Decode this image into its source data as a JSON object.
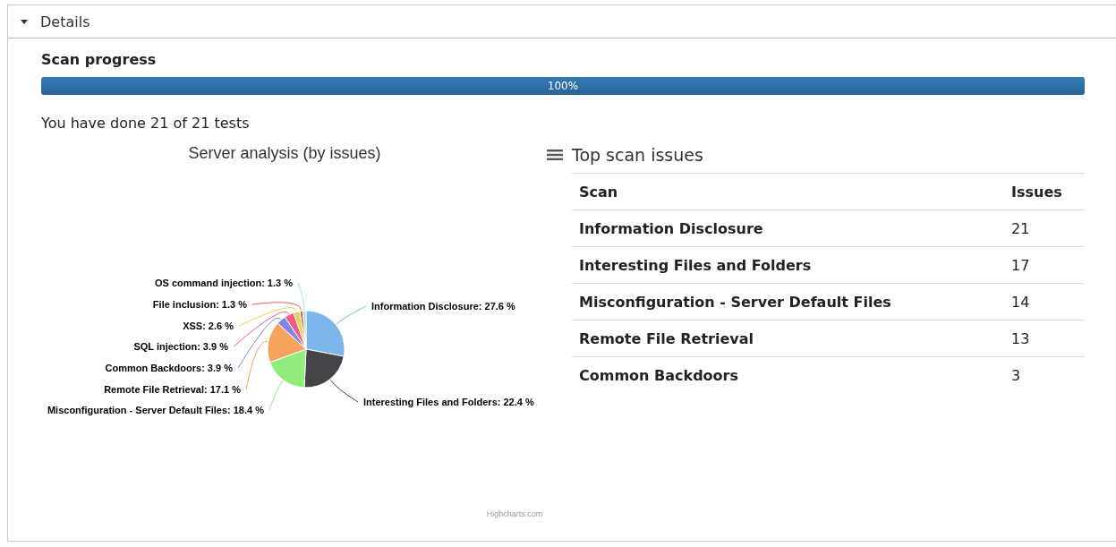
{
  "panel": {
    "title": "Details",
    "expanded": true
  },
  "progress": {
    "title": "Scan progress",
    "level": 1,
    "reading": "100%"
  },
  "summary": "You have done 21 of 21 tests",
  "chart": {
    "chart_data": {
      "type": "pie",
      "title": "Server analysis (by issues)",
      "series": [
        {
          "values": [
            27.6,
            22.4,
            18.4,
            17.1,
            3.9,
            3.9,
            2.6,
            1.3,
            1.3
          ]
        }
      ],
      "colors": [
        "#7cb5ec",
        "#434348",
        "#90ed7d",
        "#f7a35c",
        "#8085e9",
        "#f15c80",
        "#e4d354",
        "#f45b5b",
        "#91e8e1"
      ],
      "value_labels": [
        "Information Disclosure: 27.6 %",
        "Interesting Files and Folders: 22.4 %",
        "Misconfiguration - Server Default Files: 18.4 %",
        "Remote File Retrieval: 17.1 %",
        "Common Backdoors: 3.9 %",
        "SQL injection: 3.9 %",
        "XSS: 2.6 %",
        "File inclusion: 1.3 %",
        "OS command injection: 1.3 %"
      ]
    },
    "credit": "Highcharts.com"
  },
  "top_issues": {
    "title": "Top scan issues",
    "columns": [
      "Scan",
      "Issues"
    ],
    "rows": [
      [
        "Information Disclosure",
        "21"
      ],
      [
        "Interesting Files and Folders",
        "17"
      ],
      [
        "Misconfiguration - Server Default Files",
        "14"
      ],
      [
        "Remote File Retrieval",
        "13"
      ],
      [
        "Common Backdoors",
        "3"
      ]
    ]
  }
}
